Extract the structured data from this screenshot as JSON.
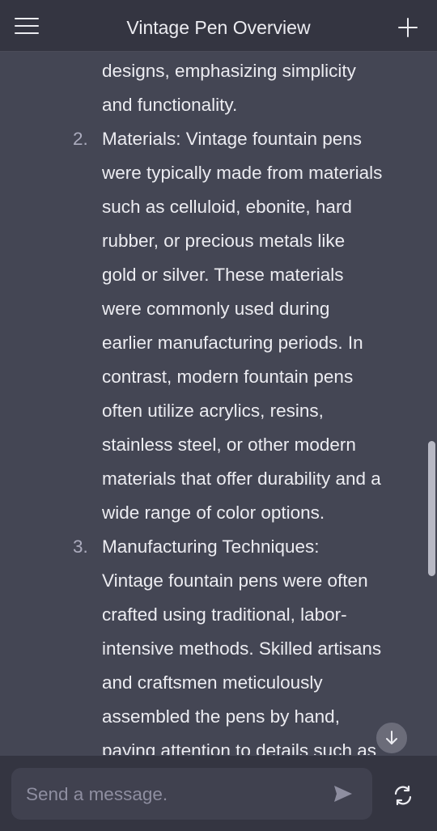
{
  "header": {
    "title": "Vintage Pen Overview",
    "menu_icon": "hamburger-menu-icon",
    "new_chat_icon": "plus-icon"
  },
  "message": {
    "partial_line_1": "designs, emphasizing simplicity",
    "partial_line_2": "and functionality.",
    "items": [
      {
        "number": "2.",
        "lines": [
          "Materials: Vintage fountain pens",
          "were typically made from materials",
          "such as celluloid, ebonite, hard",
          "rubber, or precious metals like",
          "gold or silver. These materials",
          "were commonly used during",
          "earlier manufacturing periods. In",
          "contrast, modern fountain pens",
          "often utilize acrylics, resins,",
          "stainless steel, or other modern",
          "materials that offer durability and a",
          "wide range of color options."
        ]
      },
      {
        "number": "3.",
        "lines": [
          "Manufacturing Techniques:",
          "Vintage fountain pens were often",
          "crafted using traditional, labor-",
          "intensive methods. Skilled artisans",
          "and craftsmen meticulously",
          "assembled the pens by hand,",
          "paying attention to details such as"
        ]
      }
    ]
  },
  "composer": {
    "placeholder": "Send a message.",
    "send_icon": "send-icon",
    "regenerate_icon": "regenerate-icon",
    "scroll_down_icon": "arrow-down-icon"
  },
  "colors": {
    "background": "#444654",
    "header": "#343541",
    "text": "#ececf1",
    "muted": "#8e8ea0"
  }
}
